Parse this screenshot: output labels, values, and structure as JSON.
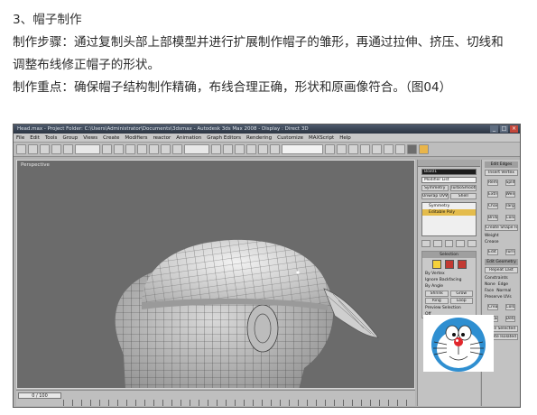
{
  "article": {
    "heading": "3、帽子制作",
    "steps_line1": "制作步骤：通过复制头部上部模型并进行扩展制作帽子的雏形，再通过拉伸、挤压、切线和",
    "steps_line2": "调整布线修正帽子的形状。",
    "focus_line": "制作重点：确保帽子结构制作精确，布线合理正确，形状和原画像符合。（图04）"
  },
  "window": {
    "title": "Head.max - Project Folder: C:\\Users\\Administrator\\Documents\\3dsmax - Autodesk 3ds Max 2008 - Display : Direct 3D",
    "menu": [
      "File",
      "Edit",
      "Tools",
      "Group",
      "Views",
      "Create",
      "Modifiers",
      "reactor",
      "Animation",
      "Graph Editors",
      "Rendering",
      "Customize",
      "MAXScript",
      "Help"
    ],
    "viewport_label": "Perspective",
    "time_slider": "0 / 100"
  },
  "modifier_panel": {
    "object_name": "Box01",
    "modifier_list": "Modifier List",
    "buttons_row1": [
      "Symmetry",
      "TurboSmooth"
    ],
    "buttons_row2": [
      "Unwrap UVW",
      "Shell"
    ],
    "stack_items": [
      "Symmetry",
      "Editable Poly"
    ],
    "selection": {
      "title": "Selection",
      "by_vertex": "By Vertex",
      "ignore_backfacing": "Ignore Backfacing",
      "by_angle": "By Angle",
      "shrink": "Shrink",
      "grow": "Grow",
      "ring": "Ring",
      "loop": "Loop",
      "preview_selection": "Preview Selection",
      "off": "Off"
    }
  },
  "edit_panel": {
    "edit_edges_title": "Edit Edges",
    "insert_vertex": "Insert Vertex",
    "remove": "Remove",
    "split": "Split",
    "extrude": "Extrude",
    "weld": "Weld",
    "chamfer": "Chamfer",
    "target_weld": "Target Weld",
    "bridge": "Bridge",
    "connect": "Connect",
    "create_shape": "Create Shape From Selection",
    "weight": "Weight",
    "crease": "Crease",
    "edit_tri": "Edit Tri.",
    "turn": "Turn",
    "edit_geometry_title": "Edit Geometry",
    "repeat_last": "Repeat Last",
    "constraints": "Constraints",
    "none": "None",
    "edge": "Edge",
    "face": "Face",
    "normal": "Normal",
    "preserve_uvs": "Preserve UVs",
    "create": "Create",
    "collapse": "Collapse",
    "attach": "Attach",
    "detach": "Detach",
    "hide_selected": "Hide Selected",
    "delete_isolated": "Delete Isolated Vertices"
  }
}
